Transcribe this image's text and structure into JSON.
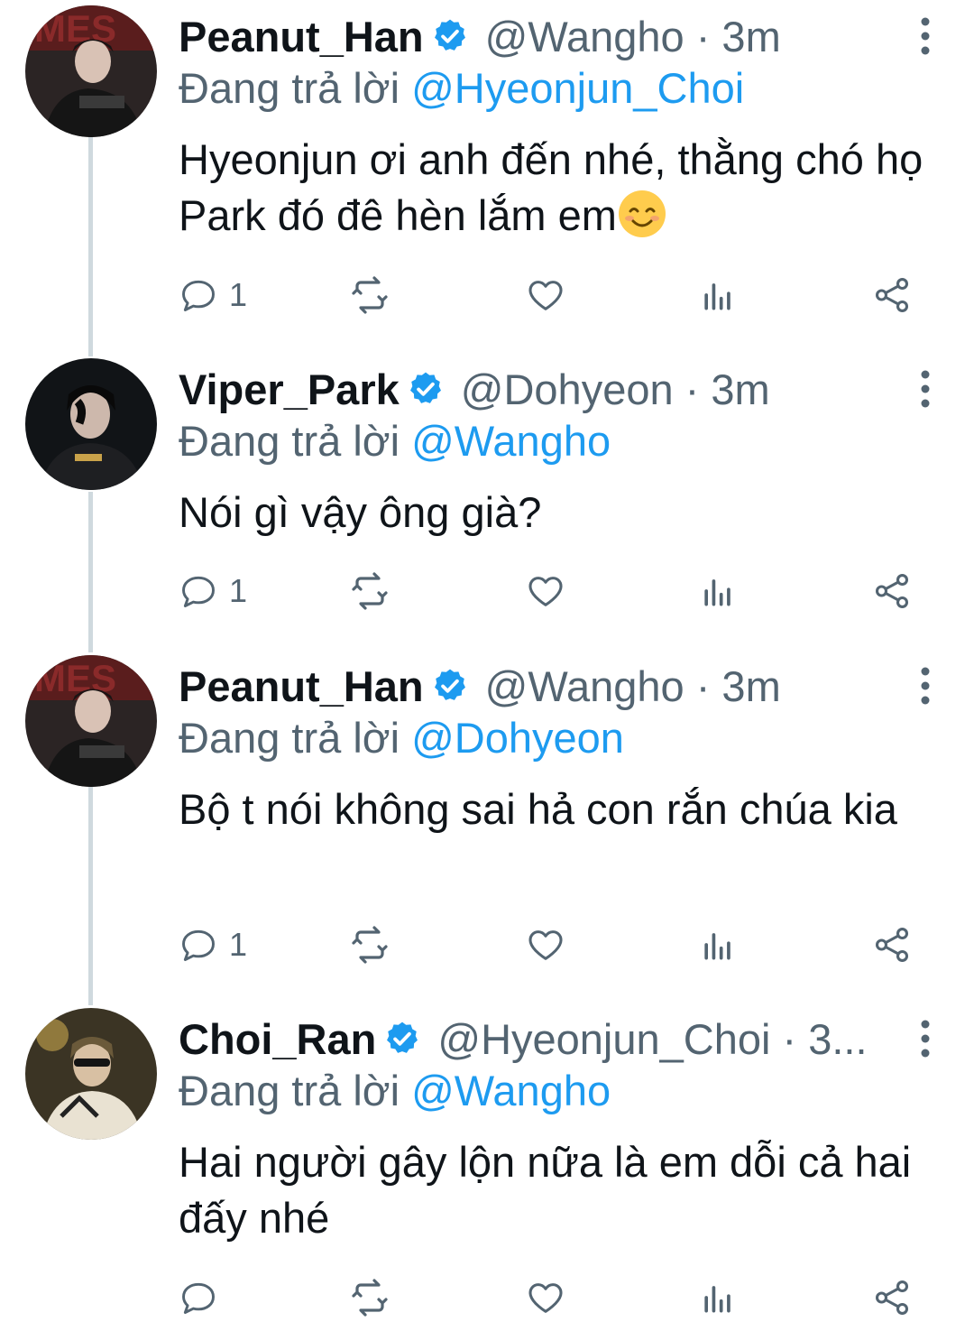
{
  "tweets": [
    {
      "name": "Peanut_Han",
      "handle_time": "@Wangho · 3m",
      "reply_prefix": "Đang trả lời ",
      "reply_to": "@Hyeonjun_Choi",
      "text": "Hyeonjun ơi anh đến nhé, thằng chó họ Park đó đê hèn lắm em",
      "reply_count": "1"
    },
    {
      "name": "Viper_Park",
      "handle_time": "@Dohyeon · 3m",
      "reply_prefix": "Đang trả lời ",
      "reply_to": "@Wangho",
      "text": "Nói gì vậy ông già?",
      "reply_count": "1"
    },
    {
      "name": "Peanut_Han",
      "handle_time": "@Wangho · 3m",
      "reply_prefix": "Đang trả lời ",
      "reply_to": "@Dohyeon",
      "text": "Bộ t nói không sai hả con rắn chúa kia",
      "reply_count": "1"
    },
    {
      "name": "Choi_Ran",
      "handle_time": "@Hyeonjun_Choi · 3...",
      "reply_prefix": "Đang trả lời ",
      "reply_to": "@Wangho",
      "text": "Hai người gây lộn nữa là em dỗi cả hai đấy nhé",
      "reply_count": ""
    }
  ],
  "icons": {
    "verified": "verified-badge-icon",
    "more": "more-vertical-icon",
    "reply": "reply-bubble-icon",
    "retweet": "retweet-icon",
    "like": "heart-icon",
    "views": "analytics-icon",
    "share": "share-icon",
    "emoji": "smiling-face-emoji"
  },
  "colors": {
    "accent": "#1d9bf0",
    "secondary_text": "#536471",
    "primary_text": "#0f1419",
    "thread_line": "#cfd9de"
  }
}
